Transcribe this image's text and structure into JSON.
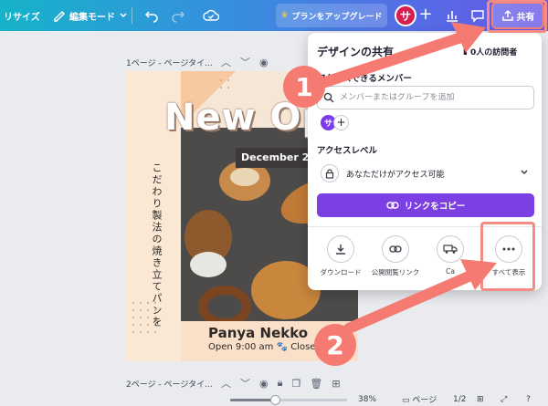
{
  "toolbar": {
    "resize_label": "リサイズ",
    "edit_mode_label": "編集モード",
    "upgrade_label": "プランをアップグレード",
    "avatar_initial": "サ",
    "share_label": "共有"
  },
  "pages": [
    {
      "label": "1ページ - ページタイ..."
    },
    {
      "label": "2ページ - ページタイ..."
    }
  ],
  "design": {
    "headline": "New Op",
    "date_text": "December 2",
    "vertical_text": "こだわり製法の焼き立てパンを",
    "shop_name": "Panya Nekko",
    "shop_hours": "Open 9:00 am 🐾 Close"
  },
  "share_panel": {
    "title": "デザインの共有",
    "visitors": "0人の訪問者",
    "members_label": "アクセスできるメンバー",
    "search_placeholder": "メンバーまたはグループを追加",
    "member_initial": "サ",
    "access_level_label": "アクセスレベル",
    "access_value": "あなただけがアクセス可能",
    "copy_link_label": "リンクをコピー",
    "actions": [
      {
        "label": "ダウンロード",
        "icon": "download-icon"
      },
      {
        "label": "公開閲覧リンク",
        "icon": "link-icon"
      },
      {
        "label": "Ca",
        "icon": "truck-icon"
      },
      {
        "label": "すべて表示",
        "icon": "more-icon"
      }
    ]
  },
  "annotations": {
    "step1": "1",
    "step2": "2"
  },
  "bottom": {
    "zoom": "38%",
    "zoom_fraction": 0.38,
    "pages_label": "ページ",
    "page_counter": "1/2"
  },
  "colors": {
    "accent_purple": "#7b3fe4",
    "annotation_red": "#f47a72",
    "avatar_red": "#d81d4f"
  }
}
